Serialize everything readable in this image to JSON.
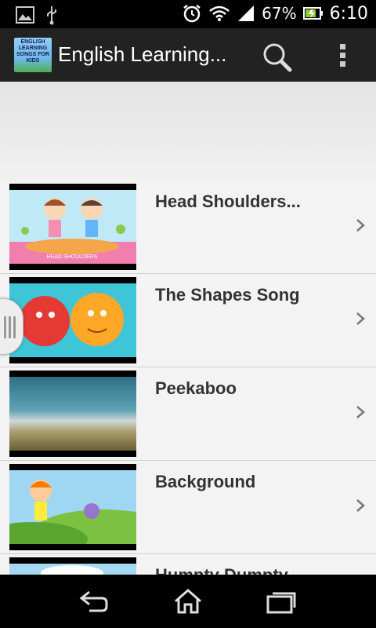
{
  "status_bar": {
    "battery": "67%",
    "time": "6:10",
    "icons": [
      "gallery-icon",
      "usb-icon",
      "alarm-icon",
      "wifi-icon",
      "signal-icon",
      "battery-icon"
    ]
  },
  "action_bar": {
    "app_icon_text": "ENGLISH LEARNING SONGS FOR KIDS",
    "title": "English Learning...",
    "icons": [
      "search-icon",
      "overflow-menu-icon"
    ]
  },
  "songs": [
    {
      "title": "Head Shoulders..."
    },
    {
      "title": "The Shapes Song"
    },
    {
      "title": "Peekaboo"
    },
    {
      "title": "Background"
    },
    {
      "title": "Humpty Dumpty"
    }
  ],
  "thumbnail_captions": {
    "head_shoulders": "HEAD   SHOULDERS"
  },
  "nav_bar": {
    "icons": [
      "back-icon",
      "home-icon",
      "recent-apps-icon"
    ]
  },
  "colors": {
    "action_bar": "#222222",
    "list_bg": "#f3f3f3",
    "title_text": "#333333"
  }
}
